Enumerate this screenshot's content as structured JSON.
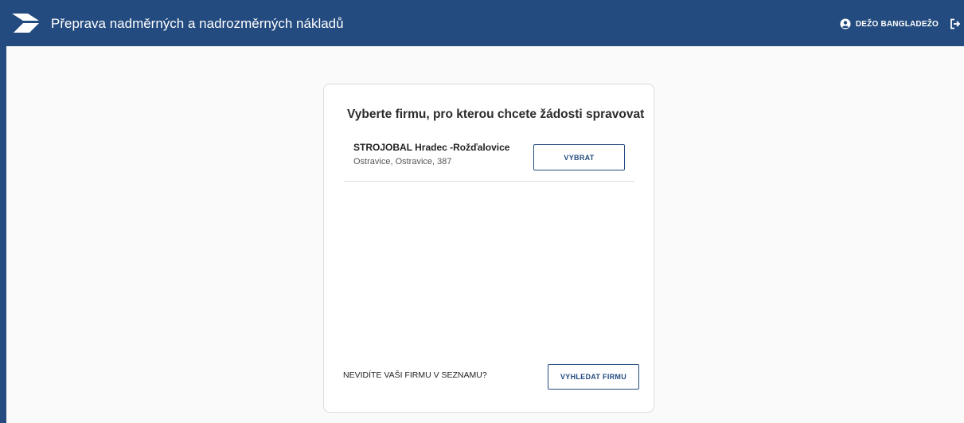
{
  "header": {
    "title": "Přeprava nadměrných a nadrozměrných nákladů",
    "logo_icon": "truck-arrow-logo",
    "user_icon": "user-circle-icon",
    "user_name": "DEŽO BANGLADEŽO",
    "logout_icon": "logout-icon"
  },
  "card": {
    "title": "Vyberte firmu, pro kterou chcete žádosti spravovat",
    "companies": [
      {
        "name": "STROJOBAL Hradec -Rožďalovice",
        "address": "Ostravice, Ostravice, 387",
        "select_label": "VYBRAT"
      }
    ],
    "footer_text": "NEVIDÍTE VAŠI FIRMU V SEZNAMU?",
    "search_label": "VYHLEDAT FIRMU"
  },
  "colors": {
    "primary": "#234b7f",
    "background": "#fafafa",
    "card_border": "#dcdcdc"
  }
}
